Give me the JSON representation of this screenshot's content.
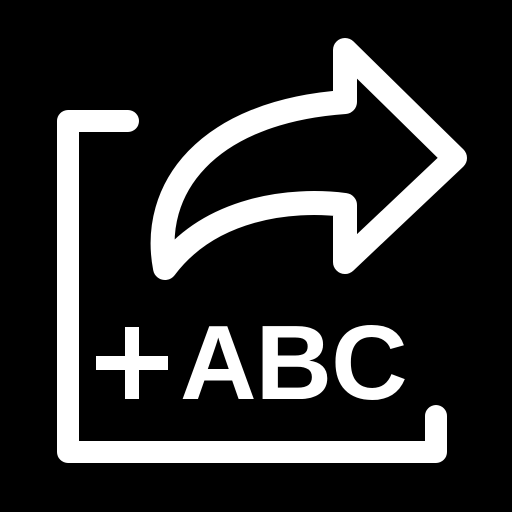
{
  "icon": {
    "name": "add-text-share-icon",
    "label": "ABC",
    "symbol": "plus",
    "colors": {
      "background": "#000000",
      "foreground": "#ffffff"
    }
  }
}
